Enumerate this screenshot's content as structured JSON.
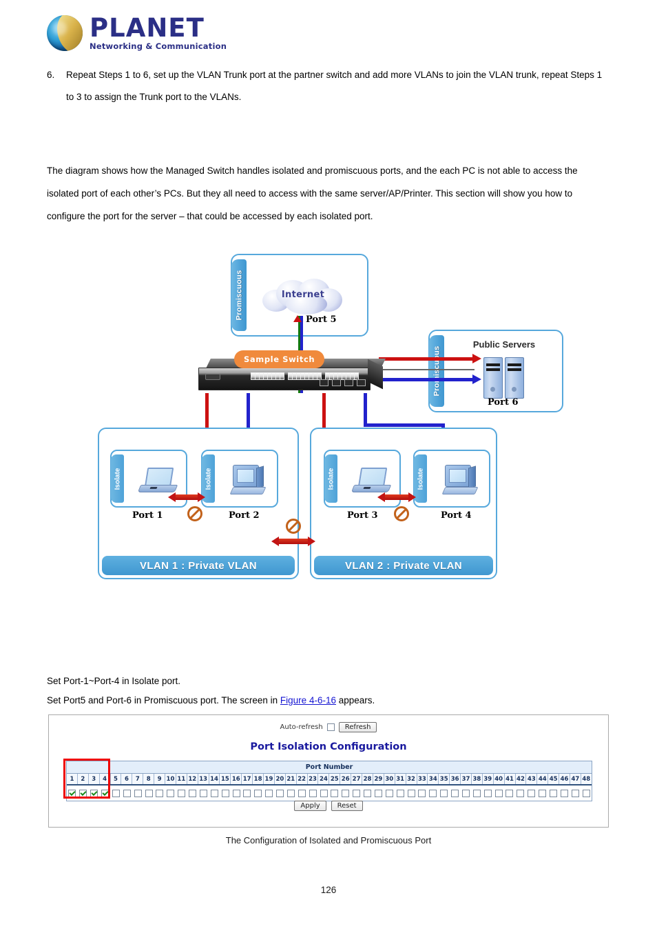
{
  "brand": {
    "name": "PLANET",
    "tagline": "Networking & Communication",
    "logo_icon": "planet-globe-icon",
    "color": "#2b2f86"
  },
  "step": {
    "number": "6.",
    "text": "Repeat Steps 1 to 6, set up the VLAN Trunk port at the partner switch and add more VLANs to join the VLAN trunk, repeat Steps 1 to 3 to assign the Trunk port to the VLANs."
  },
  "intro_paragraph": "The diagram shows how the Managed Switch handles isolated and promiscuous ports, and the each PC is not able to access the isolated port of each other’s PCs. But they all need to access with the same server/AP/Printer. This section will show you how to configure the port for the server – that could be accessed by each isolated port.",
  "diagram": {
    "internet_zone": {
      "tab_label": "Promiscuous",
      "cloud_label": "Internet",
      "port_label": "Port 5"
    },
    "servers_zone": {
      "tab_label": "Promiscuous",
      "title": "Public Servers",
      "port_label": "Port 6"
    },
    "switch": {
      "badge": "Sample Switch"
    },
    "vlan1": {
      "footer": "VLAN 1 : Private VLAN",
      "hosts": [
        {
          "tab_label": "Isolate",
          "port_label": "Port 1",
          "device": "laptop-icon"
        },
        {
          "tab_label": "Isolate",
          "port_label": "Port 2",
          "device": "desktop-icon"
        }
      ]
    },
    "vlan2": {
      "footer": "VLAN 2 : Private VLAN",
      "hosts": [
        {
          "tab_label": "Isolate",
          "port_label": "Port 3",
          "device": "laptop-icon"
        },
        {
          "tab_label": "Isolate",
          "port_label": "Port 4",
          "device": "desktop-icon"
        }
      ]
    },
    "colors": {
      "zone_border": "#56a8dc",
      "tab_fill": "#3f97d0",
      "wire_red": "#cc1111",
      "wire_blue": "#2222cc",
      "wire_green": "#117711",
      "badge_fill": "#f08a3c",
      "block_sign": "#c2621b"
    }
  },
  "instructions": {
    "isolate_line": "Set Port-1~Port-4 in Isolate port.",
    "promisc_prefix": "Set Port5 and Port-6 in Promiscuous port. The screen in ",
    "promisc_link": "Figure 4-6-16",
    "promisc_suffix": " appears.",
    "link_color": "#1414d2"
  },
  "config_panel": {
    "auto_refresh_label": "Auto-refresh",
    "auto_refresh_checked": false,
    "refresh_button": "Refresh",
    "title": "Port Isolation Configuration",
    "title_color": "#19199e",
    "table_header": "Port Number",
    "ports": [
      1,
      2,
      3,
      4,
      5,
      6,
      7,
      8,
      9,
      10,
      11,
      12,
      13,
      14,
      15,
      16,
      17,
      18,
      19,
      20,
      21,
      22,
      23,
      24,
      25,
      26,
      27,
      28,
      29,
      30,
      31,
      32,
      33,
      34,
      35,
      36,
      37,
      38,
      39,
      40,
      41,
      42,
      43,
      44,
      45,
      46,
      47,
      48
    ],
    "checked_ports": [
      1,
      2,
      3,
      4
    ],
    "apply_button": "Apply",
    "reset_button": "Reset",
    "highlight_color": "#ee0000"
  },
  "figure_caption": "The Configuration of Isolated and Promiscuous Port",
  "page_number": "126"
}
